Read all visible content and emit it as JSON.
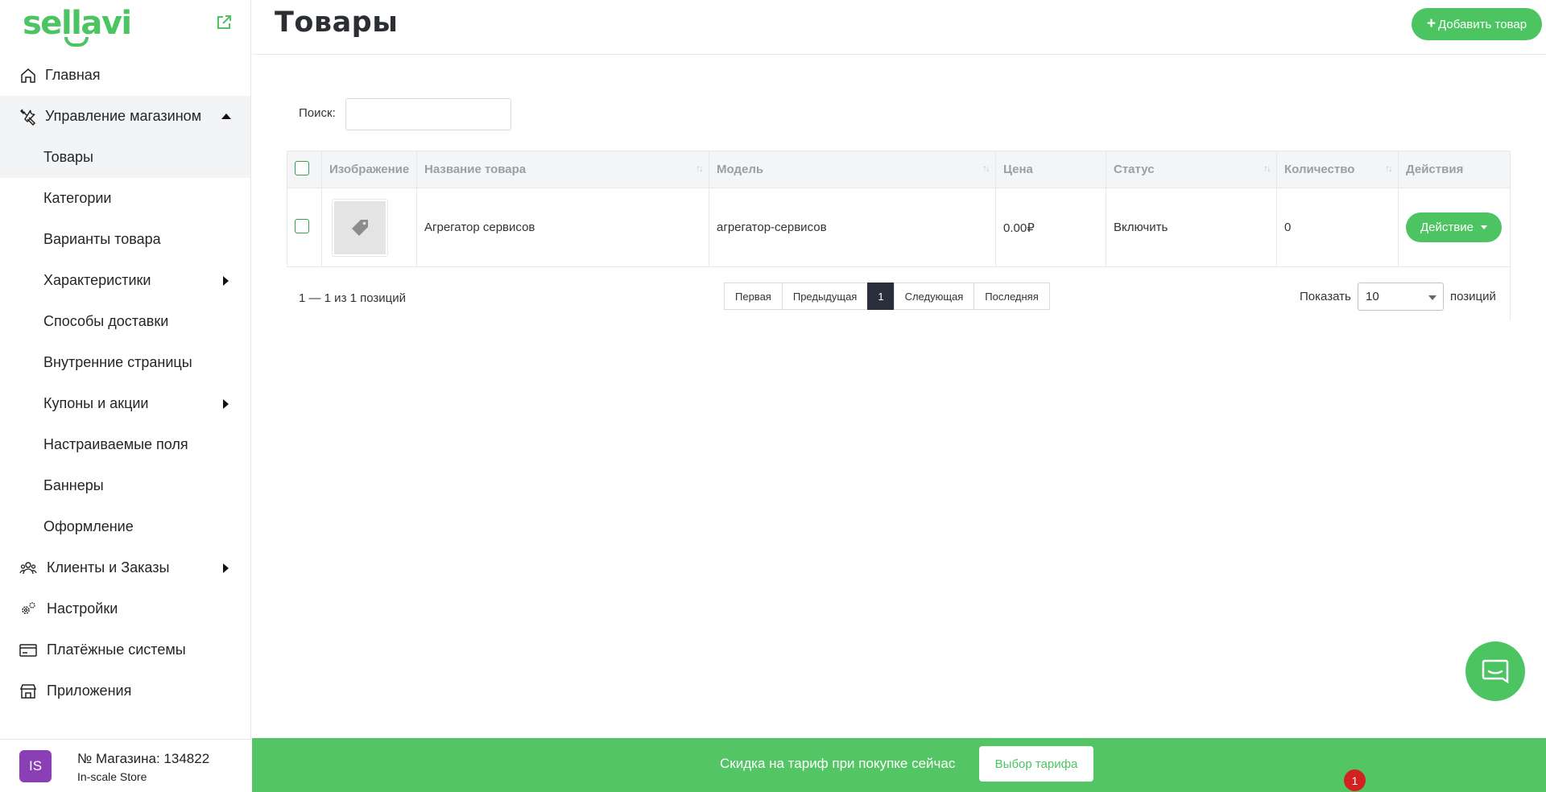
{
  "brand": {
    "logo_text": "sellavi"
  },
  "sidebar": {
    "items": [
      {
        "label": "Главная"
      },
      {
        "label": "Управление магазином"
      },
      {
        "label": "Товары"
      },
      {
        "label": "Категории"
      },
      {
        "label": "Варианты товара"
      },
      {
        "label": "Характеристики"
      },
      {
        "label": "Способы доставки"
      },
      {
        "label": "Внутренние страницы"
      },
      {
        "label": "Купоны и акции"
      },
      {
        "label": "Настраиваемые поля"
      },
      {
        "label": "Баннеры"
      },
      {
        "label": "Оформление"
      },
      {
        "label": "Клиенты и Заказы"
      },
      {
        "label": "Настройки"
      },
      {
        "label": "Платёжные системы"
      },
      {
        "label": "Приложения"
      }
    ],
    "store": {
      "avatar": "IS",
      "number": "№ Магазина: 134822",
      "name": "In-scale Store"
    }
  },
  "header": {
    "title": "Товары",
    "add_button": "Добавить товар"
  },
  "search": {
    "label": "Поиск:",
    "value": ""
  },
  "table": {
    "headers": [
      "Изображение",
      "Название товара",
      "Модель",
      "Цена",
      "Статус",
      "Количество",
      "Действия"
    ],
    "rows": [
      {
        "name": "Агрегатор сервисов",
        "model": "агрегатор-сервисов",
        "price": "0.00₽",
        "status": "Включить",
        "quantity": "0",
        "action": "Действие"
      }
    ]
  },
  "pagination": {
    "info": "1 — 1 из 1 позиций",
    "first": "Первая",
    "prev": "Предыдущая",
    "current": "1",
    "next": "Следующая",
    "last": "Последняя",
    "show_label": "Показать",
    "page_size": "10",
    "positions_label": "позиций"
  },
  "promo": {
    "text": "Скидка на тариф при покупке сейчас",
    "button": "Выбор тарифа"
  },
  "notification": {
    "count": "1"
  },
  "colors": {
    "accent": "#4cc461",
    "danger": "#e63a3a",
    "avatar": "#8b3fb5"
  }
}
